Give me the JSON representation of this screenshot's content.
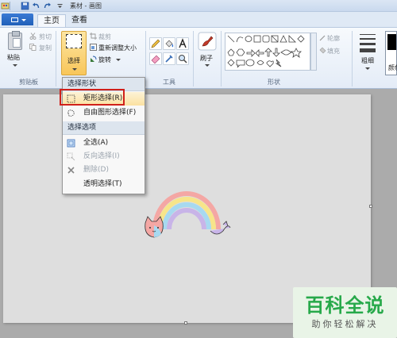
{
  "window": {
    "title": "素材 - 画图"
  },
  "tabs": [
    {
      "label": "主页",
      "active": true
    },
    {
      "label": "查看",
      "active": false
    }
  ],
  "ribbon": {
    "clipboard": {
      "paste": "粘贴",
      "cut": "剪切",
      "copy": "复制",
      "group_label": "剪贴板"
    },
    "image": {
      "select": "选择",
      "crop": "裁剪",
      "resize": "重新调整大小",
      "rotate": "旋转"
    },
    "tools": {
      "group_label": "工具"
    },
    "brushes": {
      "label": "刷子"
    },
    "shapes": {
      "outline": "轮廓",
      "fill": "填充",
      "group_label": "形状"
    },
    "size": {
      "label": "粗细"
    },
    "colors": {
      "label": "颜色"
    }
  },
  "select_menu": {
    "section_shape": "选择形状",
    "rect_select": "矩形选择(R)",
    "freeform_select": "自由图形选择(F)",
    "section_options": "选择选项",
    "select_all": "全选(A)",
    "invert_select": "反向选择(I)",
    "delete": "删除(D)",
    "transparent_select": "透明选择(T)"
  },
  "watermark": {
    "title": "百科全说",
    "subtitle": "助你轻松解决"
  },
  "colors": {
    "accent": "#f8c65a",
    "highlight_frame": "#d0201a",
    "watermark_green": "#27a94a"
  }
}
